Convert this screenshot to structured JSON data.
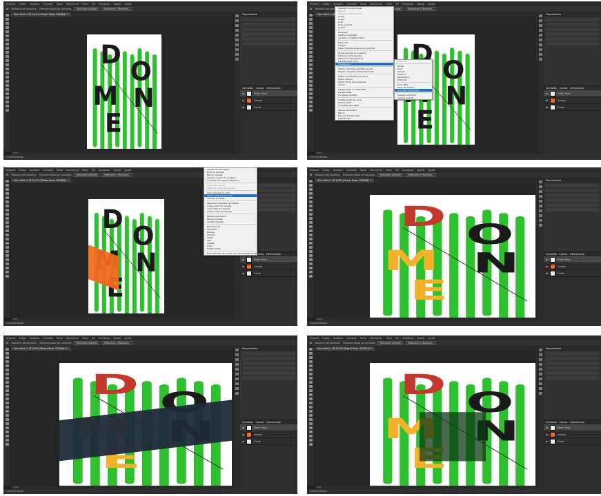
{
  "app": {
    "menus": [
      "Arquivo",
      "Editar",
      "Imagem",
      "Camada",
      "Texto",
      "Selecionar",
      "Filtro",
      "3D",
      "Visualizar",
      "Janela",
      "Ajuda"
    ],
    "statusbar": [
      "33%",
      "33%",
      "33%",
      "100%",
      "100%",
      "33%"
    ],
    "timeline_label": "Linha do tempo",
    "panel_tabs": [
      "Propriedades",
      "Camadas",
      "Canais",
      "Demarcador"
    ]
  },
  "tabs": [
    "Sem título-1 @ 16,7% (Poster Rosa, RGB/8#) *",
    "Sem título-1 @ 16,7% (Poster Rosa, RGB/8#) *",
    "Sem título-1 @ 16,7% (Poster Rosa, RGB/8#) *",
    "Sem título-1 @ 100% (Poster Rosa, RGB/8#) *",
    "Sem título-1 @ 100% (Poster Rosa, RGB/8#) *",
    "Sem título-1 @ 33,3% (Poster Rosa, RGB/8#) *"
  ],
  "optionbar": {
    "sample_label": "Tamanho da amostra:",
    "checkbox_label": "Exemplo todas as camadas",
    "button_select": "Selecionar assunto",
    "button_mask": "Selecionar e Mascarar..."
  },
  "layers": [
    [
      "Poster Rosa",
      "Laranja",
      "Fundo"
    ],
    [
      "Poster Rosa",
      "Laranja",
      "Fundo"
    ],
    [
      "Poster Rosa",
      "Laranja",
      "Fundo"
    ],
    [
      "Poster Rosa",
      "Laranja",
      "Fundo"
    ],
    [
      "Poster Rosa",
      "Laranja",
      "Fundo"
    ],
    [
      "Poster Rosa",
      "Laranja",
      "Fundo"
    ]
  ],
  "edit_menu": [
    "Desfazer Transformação",
    "Refazer",
    "Alternar o último estado",
    "Cortar",
    "Copiar",
    "Colar",
    "Colar especial",
    "Limpar",
    "Pesquisar",
    "Verificar ortografia",
    "Localizar e substituir texto",
    "Preencher",
    "Traçado",
    "Preenchimento sensível ao conteúdo",
    "Escala sensível ao conteúdo",
    "Distorção de marionete",
    "Distorção de perspectiva",
    "Transformação livre",
    "Transformar",
    "Alinhar camadas automaticamente",
    "Mesclar camadas automaticamente",
    "Definir predefinição de pincel",
    "Definir padrão",
    "Definir forma personalizada",
    "Limpar",
    "Predefinições do Adobe PDF",
    "Predefinições",
    "Conexões remotas",
    "Configurações de cores",
    "Atribuir perfil",
    "Converter para perfil",
    "Atalhos de teclado",
    "Menus",
    "Barra de ferramentas",
    "Preferências"
  ],
  "transform_submenu": [
    "Reaplicar",
    "Escala",
    "Girar",
    "Inclinar",
    "Distorcer",
    "Perspectiva",
    "Deformar",
    "Girar 180°",
    "Girar 90° Horário",
    "Girar 90° Anti-horário",
    "Inverter horizontal",
    "Inverter vertical"
  ],
  "layer_menu": [
    "Opções de mesclagem",
    "Duplicar camada",
    "Excluir camada",
    "Agrupar a partir de camadas",
    "Converter em objeto inteligente",
    "Rasterizar camada",
    "Rasterizar estilo de camada",
    "Criar máscara de corte",
    "Liberar máscara de corte",
    "Vincular camadas",
    "Selecionar camadas vinculadas",
    "Copiar estilo de camada",
    "Colar estilo de camada",
    "Limpar estilo de camada",
    "Mesclar para baixo",
    "Mesclar visíveis",
    "Achatar imagem",
    "Nenhuma cor",
    "Vermelho",
    "Laranja",
    "Amarelo",
    "Verde",
    "Azul",
    "Violeta",
    "Cinza",
    "Cartão postal",
    "Nova extrusão 3D a partir da camada selecionada"
  ],
  "poster": {
    "letters": [
      "D",
      "O",
      "N",
      "M",
      "E"
    ],
    "green": "#2fc02f",
    "orange": "#f26a1f",
    "dark": "#1a1a1a"
  }
}
